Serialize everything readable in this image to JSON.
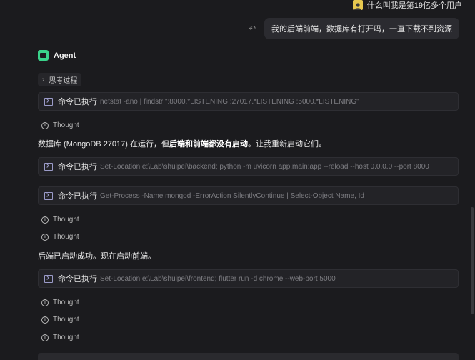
{
  "header": {
    "user_label": "什么叫我是第19亿多个用户"
  },
  "user_message": "我的后端前端，数据库有打开吗，一直下载不到资源",
  "agent": {
    "name": "Agent",
    "thinking_label": "思考过程"
  },
  "commands": [
    {
      "label": "命令已执行",
      "text": "netstat -ano | findstr \":8000.*LISTENING :27017.*LISTENING :5000.*LISTENING\""
    },
    {
      "label": "命令已执行",
      "text": "Set-Location e:\\Lab\\shuipei\\backend; python -m uvicorn app.main:app --reload --host 0.0.0.0 --port 8000"
    },
    {
      "label": "命令已执行",
      "text": "Get-Process -Name mongod -ErrorAction SilentlyContinue | Select-Object Name, Id"
    },
    {
      "label": "命令已执行",
      "text": "Set-Location e:\\Lab\\shuipei\\frontend; flutter run -d chrome --web-port 5000"
    }
  ],
  "thought_label": "Thought",
  "paragraphs": {
    "p1_pre": "数据库 (MongoDB 27017) 在运行，但",
    "p1_bold": "后端和前端都没有启动",
    "p1_post": "。让我重新启动它们。",
    "p2": "后端已启动成功。现在启动前端。"
  }
}
